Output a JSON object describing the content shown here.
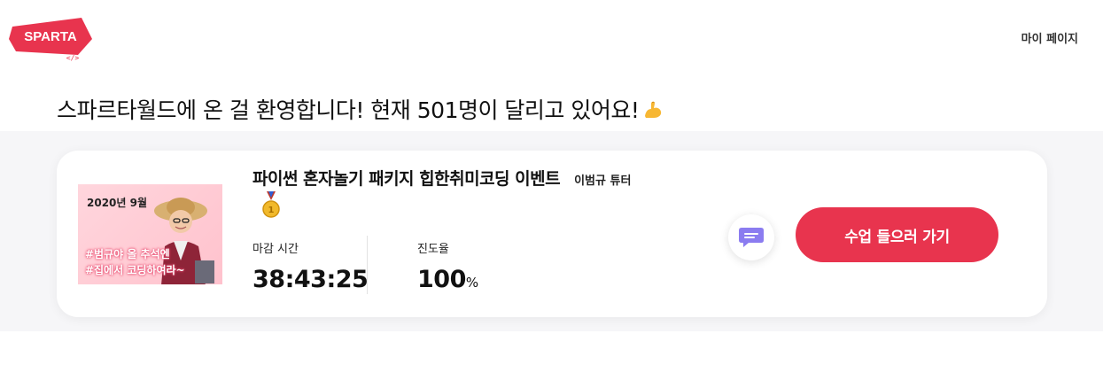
{
  "header": {
    "logo_text": "SPARTA",
    "logo_sub": "</>",
    "mypage_label": "마이 페이지"
  },
  "welcome": {
    "text": "스파르타월드에 온 걸 환영합니다! 현재 501명이 달리고 있어요!"
  },
  "course": {
    "thumbnail": {
      "date": "2020년 9월",
      "line1": "#범규야 올 추석엔",
      "line2": "#집에서 코딩하여라~"
    },
    "title": "파이썬 혼자놀기 패키지 힙한취미코딩 이벤트",
    "tutor": "이범규 튜터",
    "deadline_label": "마감 시간",
    "deadline_value": "38:43:25",
    "progress_label": "진도율",
    "progress_value": "100",
    "progress_unit": "%",
    "enter_button": "수업 들으러 가기"
  },
  "colors": {
    "brand": "#e8344e",
    "chat_icon": "#8b7cf0"
  }
}
